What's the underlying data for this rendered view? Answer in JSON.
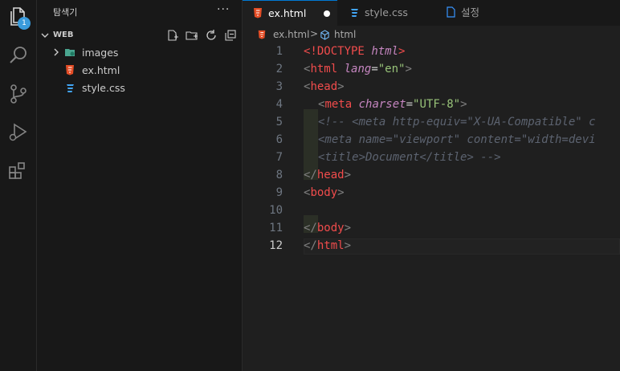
{
  "activity_bar": {
    "badge_count": "1"
  },
  "sidebar": {
    "title": "탐색기",
    "more": "···",
    "folder": "WEB",
    "items": [
      {
        "label": "images",
        "type": "folder"
      },
      {
        "label": "ex.html",
        "type": "html"
      },
      {
        "label": "style.css",
        "type": "css"
      }
    ]
  },
  "tabs": [
    {
      "label": "ex.html",
      "active": true,
      "modified": true
    },
    {
      "label": "style.css",
      "active": false
    },
    {
      "label": "설정",
      "active": false
    }
  ],
  "breadcrumb": {
    "file": "ex.html",
    "sep": ">",
    "symbol": "html"
  },
  "editor": {
    "lines": [
      {
        "n": "1"
      },
      {
        "n": "2"
      },
      {
        "n": "3"
      },
      {
        "n": "4"
      },
      {
        "n": "5"
      },
      {
        "n": "6"
      },
      {
        "n": "7"
      },
      {
        "n": "8"
      },
      {
        "n": "9"
      },
      {
        "n": "10"
      },
      {
        "n": "11"
      },
      {
        "n": "12"
      }
    ],
    "code": {
      "l1_open": "<!",
      "l1_tag": "DOCTYPE",
      "l1_attr": "html",
      "l1_close": ">",
      "l2_open": "<",
      "l2_tag": "html",
      "l2_attr": "lang",
      "l2_eq": "=",
      "l2_val": "\"en\"",
      "l2_close": ">",
      "l3_open": "<",
      "l3_tag": "head",
      "l3_close": ">",
      "l4_open": "<",
      "l4_tag": "meta",
      "l4_attr": "charset",
      "l4_eq": "=",
      "l4_val": "\"UTF-8\"",
      "l4_close": ">",
      "l5": "<!-- <meta http-equiv=\"X-UA-Compatible\" c",
      "l6": "<meta name=\"viewport\" content=\"width=devi",
      "l7": "<title>Document</title> -->",
      "l8_open": "</",
      "l8_tag": "head",
      "l8_close": ">",
      "l9_open": "<",
      "l9_tag": "body",
      "l9_close": ">",
      "l11_open": "</",
      "l11_tag": "body",
      "l11_close": ">",
      "l12_open": "</",
      "l12_tag": "html",
      "l12_close": ">"
    }
  }
}
